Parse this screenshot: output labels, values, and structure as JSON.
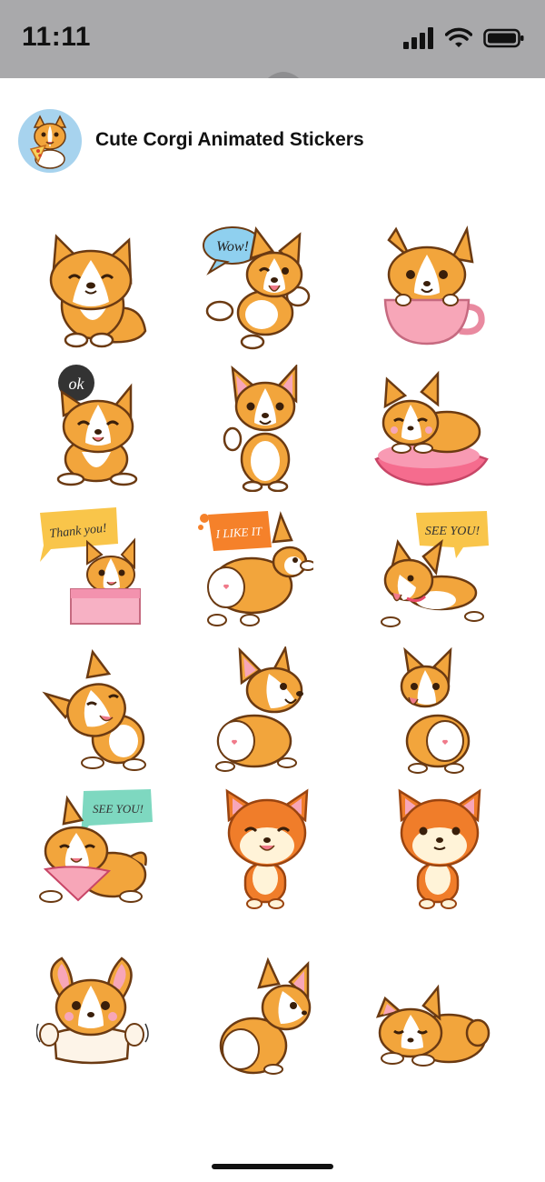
{
  "status_bar": {
    "time": "11:11"
  },
  "header": {
    "title": "Cute Corgi Animated Stickers"
  },
  "stickers": [
    {
      "caption": ""
    },
    {
      "caption": "Wow!"
    },
    {
      "caption": ""
    },
    {
      "caption": "ok"
    },
    {
      "caption": ""
    },
    {
      "caption": ""
    },
    {
      "caption": "Thank you!"
    },
    {
      "caption": "I LIKE IT"
    },
    {
      "caption": "SEE YOU!"
    },
    {
      "caption": ""
    },
    {
      "caption": ""
    },
    {
      "caption": ""
    },
    {
      "caption": "SEE YOU!"
    },
    {
      "caption": ""
    },
    {
      "caption": ""
    },
    {
      "caption": ""
    },
    {
      "caption": ""
    },
    {
      "caption": ""
    }
  ],
  "colors": {
    "corgi_orange": "#f2a53c",
    "outline": "#6b3a12",
    "cream": "#fff6e8",
    "pink": "#f7a6b8",
    "bubble_blue": "#8fd0ef",
    "bubble_yellow": "#f9c54a",
    "bubble_orange": "#f5812a",
    "bubble_teal": "#7ed8c0",
    "bubble_dark": "#333333"
  }
}
